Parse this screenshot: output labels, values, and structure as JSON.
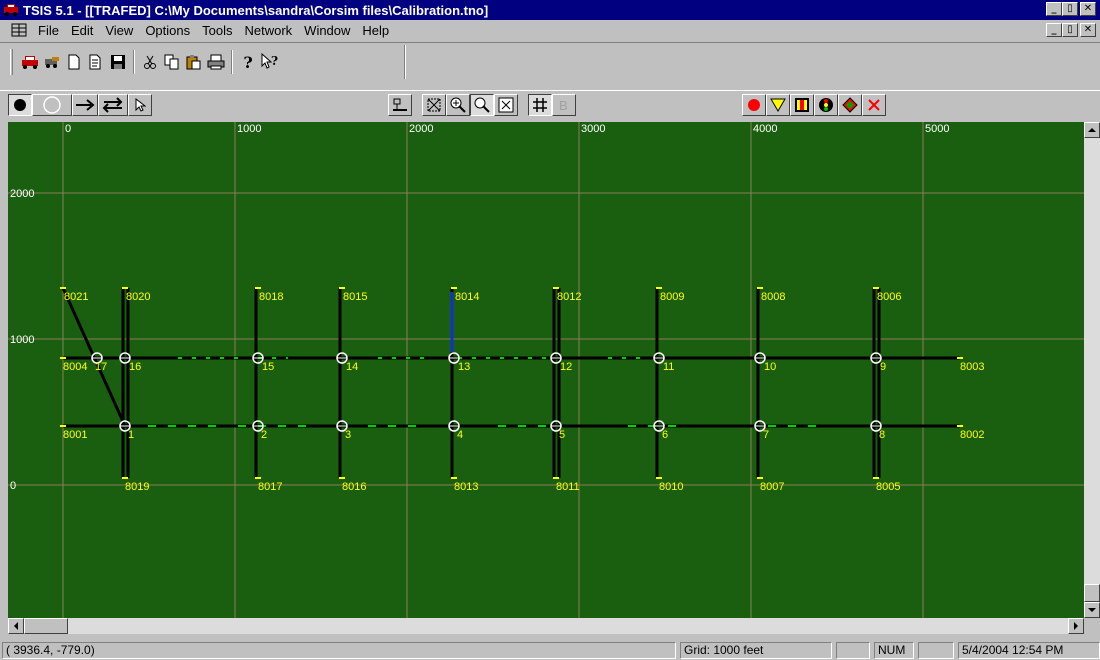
{
  "window": {
    "title": "TSIS 5.1 - [[TRAFED] C:\\My Documents\\sandra\\Corsim files\\Calibration.tno]",
    "minimize": "_",
    "maximize": "▯",
    "close": "✕"
  },
  "menu": {
    "items": [
      {
        "label": "File"
      },
      {
        "label": "Edit"
      },
      {
        "label": "View"
      },
      {
        "label": "Options"
      },
      {
        "label": "Tools"
      },
      {
        "label": "Network"
      },
      {
        "label": "Window"
      },
      {
        "label": "Help"
      }
    ]
  },
  "toolbar1": {
    "icons": [
      "car-icon",
      "vehicles-icon",
      "new-icon",
      "open-icon",
      "save-icon",
      "cut-icon",
      "copy-icon",
      "paste-icon",
      "print-icon",
      "help-icon",
      "context-help-icon"
    ]
  },
  "toolbar2": {
    "tools": [
      "node-tool",
      "empty-node-tool",
      "link-tool",
      "two-way-link-tool",
      "select-tool",
      "properties-tool",
      "zoom-window-tool",
      "zoom-in-tool",
      "zoom-out-tool",
      "zoom-fit-tool",
      "grid-toggle",
      "background-tool",
      "red-node-tool",
      "yield-sign-tool",
      "detector-tool",
      "signal-tool",
      "direction-tool",
      "delete-tool"
    ]
  },
  "map": {
    "x_ticks": [
      "0",
      "1000",
      "2000",
      "3000",
      "4000",
      "5000"
    ],
    "y_ticks": [
      "2000",
      "1000",
      "0"
    ],
    "grid_color": "#8a7f5a",
    "background_color": "#1a5e0f",
    "link_color": "#000000",
    "label_color": "#ffff00",
    "top_nodes": [
      "8021",
      "8020",
      "8018",
      "8015",
      "8014",
      "8012",
      "8009",
      "8008",
      "8006"
    ],
    "upper_row": [
      "17",
      "16",
      "15",
      "14",
      "13",
      "12",
      "11",
      "10",
      "9"
    ],
    "upper_row_left": "8004",
    "upper_row_right": "8003",
    "lower_row": [
      "1",
      "2",
      "3",
      "4",
      "5",
      "6",
      "7",
      "8"
    ],
    "lower_row_left": "8001",
    "lower_row_right": "8002",
    "bottom_nodes": [
      "8019",
      "8017",
      "8016",
      "8013",
      "8011",
      "8010",
      "8007",
      "8005"
    ]
  },
  "status": {
    "coords": "( 3936.4,  -779.0)",
    "grid": "Grid: 1000 feet",
    "num": "NUM",
    "datetime": "5/4/2004  12:54 PM"
  }
}
